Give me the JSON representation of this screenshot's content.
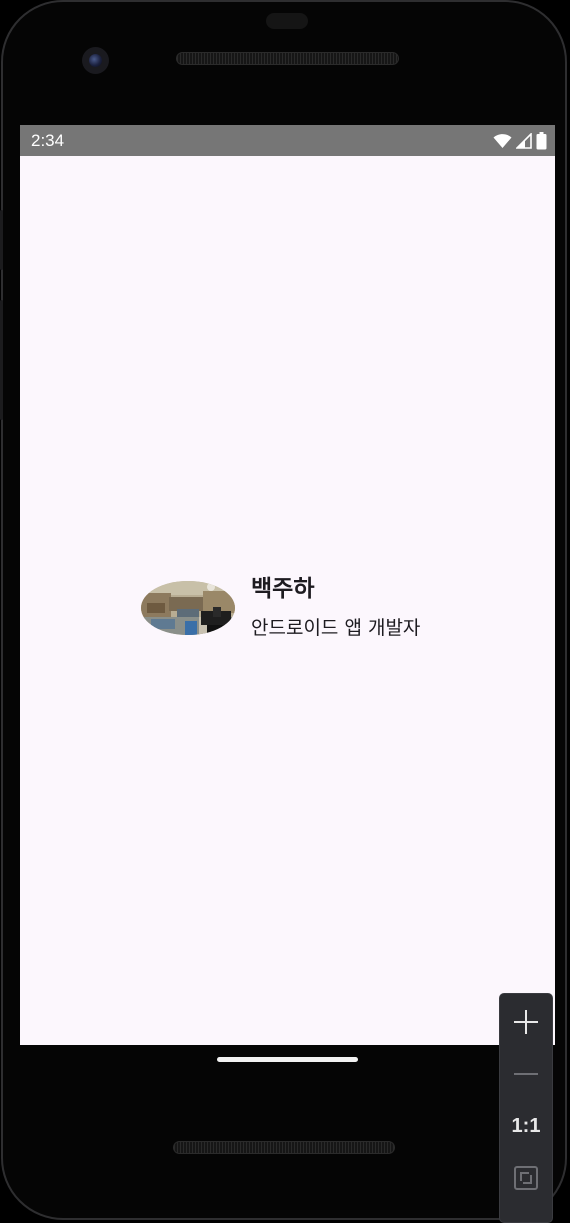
{
  "status_bar": {
    "time": "2:34",
    "icons": [
      "wifi-icon",
      "cell-signal-icon",
      "battery-icon"
    ],
    "background": "#767676"
  },
  "profile": {
    "name": "백주하",
    "role": "안드로이드 앱 개발자",
    "image": "game-screenshot-thumbnail"
  },
  "emulator_controls": {
    "zoom_in_icon": "plus-icon",
    "zoom_out_icon": "minus-icon",
    "reset_label": "1:1",
    "fit_icon": "fit-screen-icon"
  },
  "colors": {
    "screen_background": "#fcf7fd",
    "text": "#1d1b20",
    "panel": "#2b2c30"
  }
}
